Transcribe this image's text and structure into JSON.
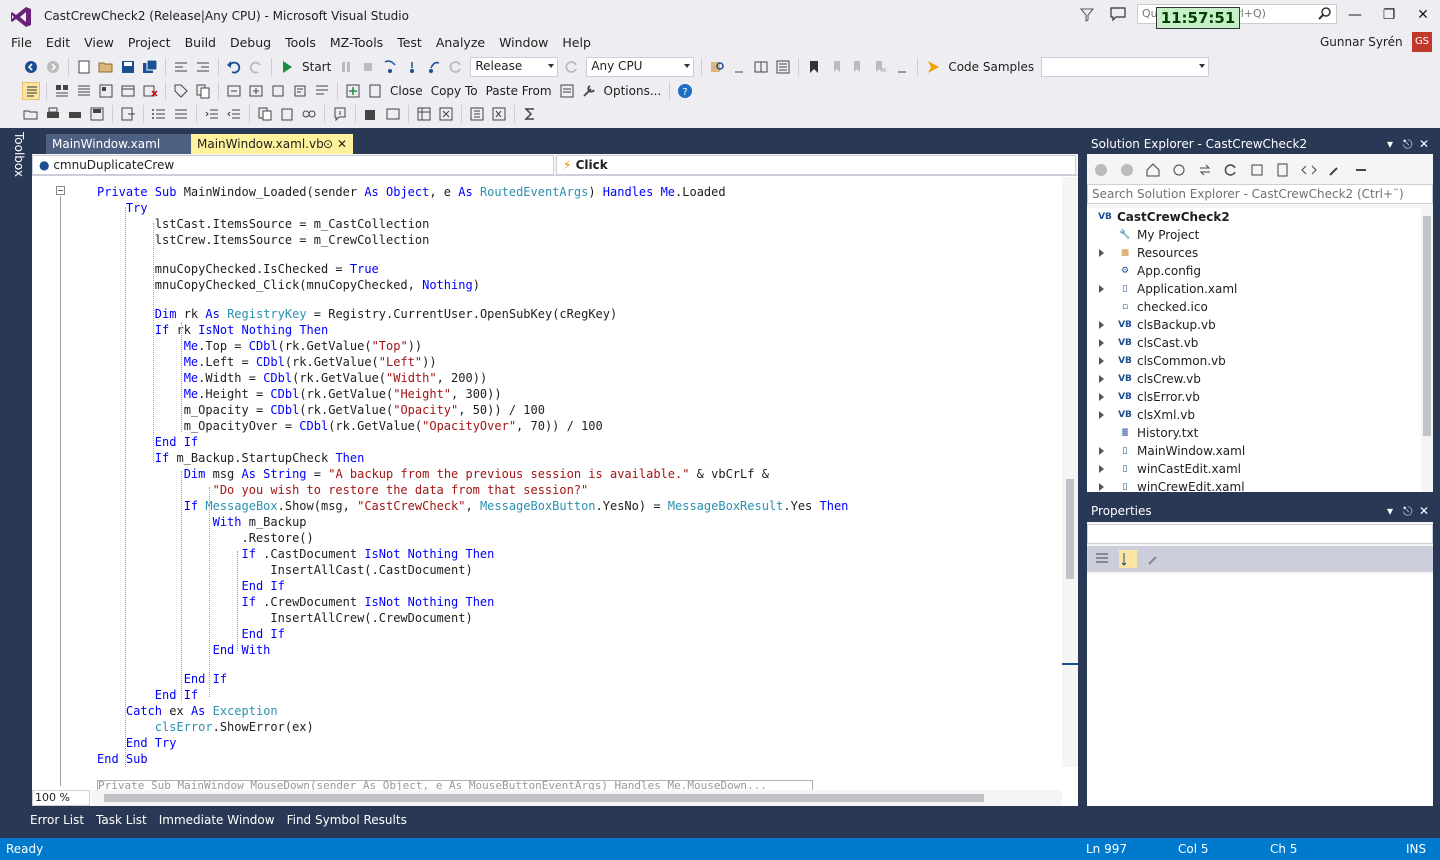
{
  "window": {
    "title": "CastCrewCheck2 (Release|Any CPU) - Microsoft Visual Studio",
    "quick_launch_placeholder": "Quick Launch (Ctrl+Q)",
    "clock": "11:57:51"
  },
  "menu": [
    "File",
    "Edit",
    "View",
    "Project",
    "Build",
    "Debug",
    "Tools",
    "MZ-Tools",
    "Test",
    "Analyze",
    "Window",
    "Help"
  ],
  "user": {
    "name": "Gunnar Syrén",
    "initials": "GS"
  },
  "toolbar1": {
    "start_label": "Start",
    "config": "Release",
    "platform": "Any CPU",
    "code_samples": "Code Samples"
  },
  "toolbar2": {
    "close_label": "Close",
    "copy_to_label": "Copy To",
    "paste_from_label": "Paste From",
    "options_label": "Options..."
  },
  "toolbox_label": "Toolbox",
  "doc_tabs": [
    {
      "label": "MainWindow.xaml"
    },
    {
      "label": "MainWindow.xaml.vb"
    }
  ],
  "nav": {
    "left": "cmnuDuplicateCrew",
    "right": "Click"
  },
  "code": [
    [
      [
        "kw",
        "Private Sub "
      ],
      [
        "pl",
        "MainWindow_Loaded(sender "
      ],
      [
        "kw",
        "As Object"
      ],
      [
        "pl",
        ", e "
      ],
      [
        "kw",
        "As "
      ],
      [
        "ty",
        "RoutedEventArgs"
      ],
      [
        "pl",
        ") "
      ],
      [
        "kw",
        "Handles Me"
      ],
      [
        "pl",
        ".Loaded"
      ]
    ],
    [
      [
        "kw",
        "    Try"
      ]
    ],
    [
      [
        "pl",
        "        lstCast.ItemsSource = m_CastCollection"
      ]
    ],
    [
      [
        "pl",
        "        lstCrew.ItemsSource = m_CrewCollection"
      ]
    ],
    [],
    [
      [
        "pl",
        "        mnuCopyChecked.IsChecked = "
      ],
      [
        "kw",
        "True"
      ]
    ],
    [
      [
        "pl",
        "        mnuCopyChecked_Click(mnuCopyChecked, "
      ],
      [
        "kw",
        "Nothing"
      ],
      [
        "pl",
        ")"
      ]
    ],
    [],
    [
      [
        "kw",
        "        Dim "
      ],
      [
        "pl",
        "rk "
      ],
      [
        "kw",
        "As "
      ],
      [
        "ty",
        "RegistryKey"
      ],
      [
        "pl",
        " = Registry.CurrentUser.OpenSubKey(cRegKey)"
      ]
    ],
    [
      [
        "kw",
        "        If "
      ],
      [
        "pl",
        "rk "
      ],
      [
        "kw",
        "IsNot Nothing Then"
      ]
    ],
    [
      [
        "kw",
        "            Me"
      ],
      [
        "pl",
        ".Top = "
      ],
      [
        "kw",
        "CDbl"
      ],
      [
        "pl",
        "(rk.GetValue("
      ],
      [
        "st",
        "\"Top\""
      ],
      [
        "pl",
        "))"
      ]
    ],
    [
      [
        "kw",
        "            Me"
      ],
      [
        "pl",
        ".Left = "
      ],
      [
        "kw",
        "CDbl"
      ],
      [
        "pl",
        "(rk.GetValue("
      ],
      [
        "st",
        "\"Left\""
      ],
      [
        "pl",
        "))"
      ]
    ],
    [
      [
        "kw",
        "            Me"
      ],
      [
        "pl",
        ".Width = "
      ],
      [
        "kw",
        "CDbl"
      ],
      [
        "pl",
        "(rk.GetValue("
      ],
      [
        "st",
        "\"Width\""
      ],
      [
        "pl",
        ", 200))"
      ]
    ],
    [
      [
        "kw",
        "            Me"
      ],
      [
        "pl",
        ".Height = "
      ],
      [
        "kw",
        "CDbl"
      ],
      [
        "pl",
        "(rk.GetValue("
      ],
      [
        "st",
        "\"Height\""
      ],
      [
        "pl",
        ", 300))"
      ]
    ],
    [
      [
        "pl",
        "            m_Opacity = "
      ],
      [
        "kw",
        "CDbl"
      ],
      [
        "pl",
        "(rk.GetValue("
      ],
      [
        "st",
        "\"Opacity\""
      ],
      [
        "pl",
        ", 50)) / 100"
      ]
    ],
    [
      [
        "pl",
        "            m_OpacityOver = "
      ],
      [
        "kw",
        "CDbl"
      ],
      [
        "pl",
        "(rk.GetValue("
      ],
      [
        "st",
        "\"OpacityOver\""
      ],
      [
        "pl",
        ", 70)) / 100"
      ]
    ],
    [
      [
        "kw",
        "        End If"
      ]
    ],
    [
      [
        "kw",
        "        If "
      ],
      [
        "pl",
        "m_Backup.StartupCheck "
      ],
      [
        "kw",
        "Then"
      ]
    ],
    [
      [
        "kw",
        "            Dim "
      ],
      [
        "pl",
        "msg "
      ],
      [
        "kw",
        "As String"
      ],
      [
        "pl",
        " = "
      ],
      [
        "st",
        "\"A backup from the previous session is available.\""
      ],
      [
        "pl",
        " & vbCrLf &"
      ]
    ],
    [
      [
        "st",
        "                \"Do you wish to restore the data from that session?\""
      ]
    ],
    [
      [
        "kw",
        "            If "
      ],
      [
        "ty",
        "MessageBox"
      ],
      [
        "pl",
        ".Show(msg, "
      ],
      [
        "st",
        "\"CastCrewCheck\""
      ],
      [
        "pl",
        ", "
      ],
      [
        "ty",
        "MessageBoxButton"
      ],
      [
        "pl",
        ".YesNo) = "
      ],
      [
        "ty",
        "MessageBoxResult"
      ],
      [
        "pl",
        ".Yes "
      ],
      [
        "kw",
        "Then"
      ]
    ],
    [
      [
        "kw",
        "                With "
      ],
      [
        "pl",
        "m_Backup"
      ]
    ],
    [
      [
        "pl",
        "                    .Restore()"
      ]
    ],
    [
      [
        "kw",
        "                    If "
      ],
      [
        "pl",
        ".CastDocument "
      ],
      [
        "kw",
        "IsNot Nothing Then"
      ]
    ],
    [
      [
        "pl",
        "                        InsertAllCast(.CastDocument)"
      ]
    ],
    [
      [
        "kw",
        "                    End If"
      ]
    ],
    [
      [
        "kw",
        "                    If "
      ],
      [
        "pl",
        ".CrewDocument "
      ],
      [
        "kw",
        "IsNot Nothing Then"
      ]
    ],
    [
      [
        "pl",
        "                        InsertAllCrew(.CrewDocument)"
      ]
    ],
    [
      [
        "kw",
        "                    End If"
      ]
    ],
    [
      [
        "kw",
        "                End With"
      ]
    ],
    [],
    [
      [
        "kw",
        "            End If"
      ]
    ],
    [
      [
        "kw",
        "        End If"
      ]
    ],
    [
      [
        "kw",
        "    Catch "
      ],
      [
        "pl",
        "ex "
      ],
      [
        "kw",
        "As "
      ],
      [
        "ty",
        "Exception"
      ]
    ],
    [
      [
        "ty",
        "        clsError"
      ],
      [
        "pl",
        ".ShowError(ex)"
      ]
    ],
    [
      [
        "kw",
        "    End Try"
      ]
    ],
    [
      [
        "kw",
        "End Sub"
      ]
    ]
  ],
  "collapsed_line": "Private Sub MainWindow_MouseDown(sender As Object, e As MouseButtonEventArgs) Handles Me.MouseDown...",
  "zoom": "100 %",
  "solution_explorer": {
    "title": "Solution Explorer - CastCrewCheck2",
    "search_placeholder": "Search Solution Explorer - CastCrewCheck2 (Ctrl+¨)",
    "items": [
      {
        "label": "CastCrewCheck2",
        "icon": "vb-project-icon",
        "indent": 0,
        "expander": false
      },
      {
        "label": "My Project",
        "icon": "wrench-icon",
        "indent": 1,
        "expander": false
      },
      {
        "label": "Resources",
        "icon": "folder-icon",
        "indent": 1,
        "expander": true
      },
      {
        "label": "App.config",
        "icon": "config-file-icon",
        "indent": 1,
        "expander": false
      },
      {
        "label": "Application.xaml",
        "icon": "xaml-file-icon",
        "indent": 1,
        "expander": true
      },
      {
        "label": "checked.ico",
        "icon": "file-icon",
        "indent": 1,
        "expander": false
      },
      {
        "label": "clsBackup.vb",
        "icon": "vb-file-icon",
        "indent": 1,
        "expander": true
      },
      {
        "label": "clsCast.vb",
        "icon": "vb-file-icon",
        "indent": 1,
        "expander": true
      },
      {
        "label": "clsCommon.vb",
        "icon": "vb-file-icon",
        "indent": 1,
        "expander": true
      },
      {
        "label": "clsCrew.vb",
        "icon": "vb-file-icon",
        "indent": 1,
        "expander": true
      },
      {
        "label": "clsError.vb",
        "icon": "vb-file-icon",
        "indent": 1,
        "expander": true
      },
      {
        "label": "clsXml.vb",
        "icon": "vb-file-icon",
        "indent": 1,
        "expander": true
      },
      {
        "label": "History.txt",
        "icon": "text-file-icon",
        "indent": 1,
        "expander": false
      },
      {
        "label": "MainWindow.xaml",
        "icon": "xaml-file-icon",
        "indent": 1,
        "expander": true
      },
      {
        "label": "winCastEdit.xaml",
        "icon": "xaml-file-icon",
        "indent": 1,
        "expander": true
      },
      {
        "label": "winCrewEdit.xaml",
        "icon": "xaml-file-icon",
        "indent": 1,
        "expander": true
      }
    ]
  },
  "properties": {
    "title": "Properties"
  },
  "bottom_tabs": [
    "Error List",
    "Task List",
    "Immediate Window",
    "Find Symbol Results"
  ],
  "status": {
    "state": "Ready",
    "ln": "Ln 997",
    "col": "Col 5",
    "ch": "Ch 5",
    "mode": "INS"
  },
  "colors": {
    "accent": "#007ACC",
    "dark_bg": "#293955",
    "active_tab": "#FFF29D"
  }
}
